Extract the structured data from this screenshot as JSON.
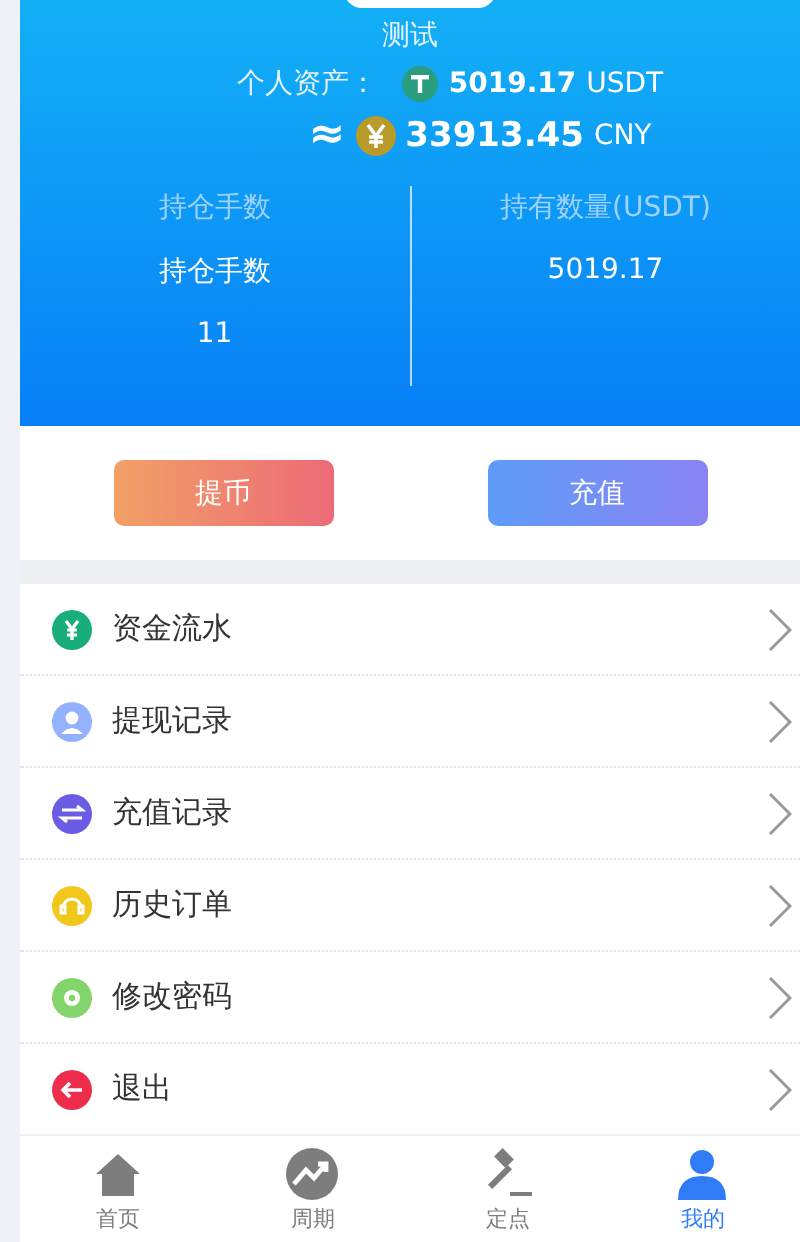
{
  "header": {
    "name": "测试",
    "assets_label": "个人资产：",
    "usdt_amount": "5019.17",
    "usdt_unit": "USDT",
    "approx": "≈",
    "cny_amount": "33913.45",
    "cny_unit": "CNY"
  },
  "stats": [
    {
      "label": "持仓手数",
      "values": [
        "持仓手数",
        "11"
      ]
    },
    {
      "label": "持有数量(USDT)",
      "values": [
        "5019.17"
      ]
    }
  ],
  "buttons": [
    {
      "label": "提币",
      "kind": "withdraw"
    },
    {
      "label": "充值",
      "kind": "deposit"
    }
  ],
  "menu": [
    {
      "label": "资金流水",
      "kind": "funds"
    },
    {
      "label": "提现记录",
      "kind": "withdrawals"
    },
    {
      "label": "充值记录",
      "kind": "deposits"
    },
    {
      "label": "历史订单",
      "kind": "orders"
    },
    {
      "label": "修改密码",
      "kind": "password"
    },
    {
      "label": "退出",
      "kind": "logout"
    }
  ],
  "nav": [
    {
      "label": "首页",
      "kind": "home",
      "selected": false
    },
    {
      "label": "周期",
      "kind": "cycle",
      "selected": false
    },
    {
      "label": "定点",
      "kind": "fixed",
      "selected": false
    },
    {
      "label": "我的",
      "kind": "me",
      "selected": true
    }
  ]
}
